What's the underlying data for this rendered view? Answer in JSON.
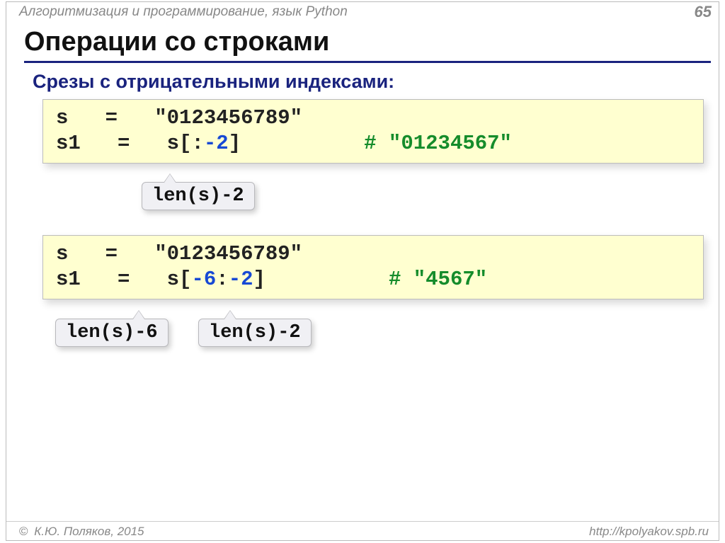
{
  "header": {
    "course_title": "Алгоритмизация и программирование, язык Python",
    "page_number": "65"
  },
  "headings": {
    "main": "Операции со строками",
    "sub": "Срезы с отрицательными индексами:"
  },
  "code_block_1": {
    "line1_a": "s",
    "line1_b": "=",
    "line1_c": "\"0123456789\"",
    "line2_a": "s1",
    "line2_b": "=",
    "line2_c": "s[:",
    "line2_d": "-2",
    "line2_e": "]",
    "gap1": "          ",
    "comment_hash": "#",
    "comment_text": " \"01234567\""
  },
  "callouts_1": {
    "text": "len(s)-2"
  },
  "code_block_2": {
    "line1_a": "s",
    "line1_b": "=",
    "line1_c": "\"0123456789\"",
    "line2_a": "s1",
    "line2_b": "=",
    "line2_c": "s[",
    "line2_d": "-6",
    "line2_e": ":",
    "line2_f": "-2",
    "line2_g": "]",
    "gap": "          ",
    "comment_hash": "#",
    "comment_text": " \"4567\""
  },
  "callouts_2": {
    "a": "len(s)-6",
    "b": "len(s)-2"
  },
  "footer": {
    "copyright": " К.Ю. Поляков, 2015",
    "url": "http://kpolyakov.spb.ru"
  }
}
